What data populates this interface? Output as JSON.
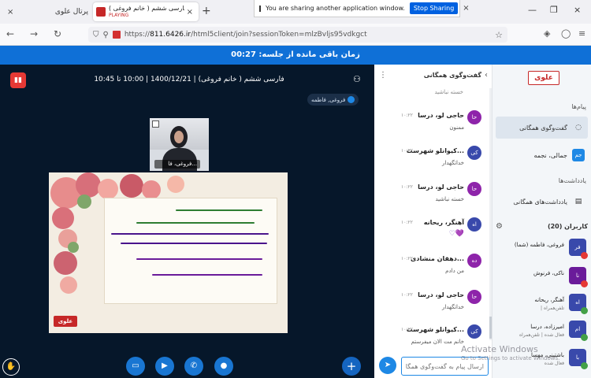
{
  "browser": {
    "tabs": [
      {
        "title": "پرتال علوی"
      },
      {
        "title": "علوی - فارسی ششم ( خانم فروغی )",
        "status": "PLAYING"
      }
    ],
    "new_tab": "+",
    "close_glyph": "×",
    "sharing": {
      "text": "You are sharing another application window.",
      "button": "Stop Sharing"
    },
    "url": {
      "prefix": "https://",
      "host": "811.6426.ir",
      "path": "/html5client/join?sessionToken=mlzBvljs95vdkgct"
    },
    "window_controls": {
      "minimize": "—",
      "restore": "❐",
      "close": "×"
    }
  },
  "app": {
    "timer": "زمان باقی مانده از جلسه: 00:27",
    "session_title": "فارسی ششم ( خانم فروغی) | 1400/12/21 | 10:00 تا 10:45",
    "presenter_tag": "فروغی, فاطمه",
    "webcam_label": "فروغی، فا...",
    "slide_logo": "علوی"
  },
  "chat": {
    "title": "گفت‌وگوی همگانی",
    "input_placeholder": "ارسال پیام به گفت‌وگوی همگانی",
    "top_fragment": "خسته نباشید",
    "messages": [
      {
        "avatar": "حا",
        "name": "حاجی لو، درسا",
        "time": "۱۰:۲۲",
        "text": "ممنون",
        "color": "#8e24aa"
      },
      {
        "avatar": "کی",
        "name": "کیوانلو شهرست...",
        "time": "۱۰:۲۲",
        "text": "خداتگهدار",
        "color": "#3949ab"
      },
      {
        "avatar": "حا",
        "name": "حاجی لو، درسا",
        "time": "۱۰:۲۲",
        "text": "خسته نباشید",
        "color": "#8e24aa"
      },
      {
        "avatar": "اه",
        "name": "آهنگر، ریحانه",
        "time": "۱۰:۲۲",
        "text": "",
        "hearts": "♡💜",
        "color": "#3949ab"
      },
      {
        "avatar": "ده",
        "name": "دهقان منشادی...",
        "time": "۱۰:۲۲",
        "text": "من دادم",
        "color": "#8e24aa"
      },
      {
        "avatar": "حا",
        "name": "حاجی لو، درسا",
        "time": "۱۰:۲۲",
        "text": "خداتگهدار",
        "color": "#8e24aa"
      },
      {
        "avatar": "کی",
        "name": "کیوانلو شهرست...",
        "time": "۱۰:۲۲",
        "text": "خانم مت الان میفرستم",
        "color": "#3949ab"
      }
    ]
  },
  "sidebar": {
    "logo": "علوی",
    "messages_heading": "پیام‌ها",
    "public_chat": "گفت‌وگوی همگانی",
    "private_chat": "جمالی، نجمه",
    "private_avatar": "جم",
    "notes_heading": "یادداشت‌ها",
    "shared_notes": "یادداشت‌های همگانی",
    "users_heading": "کاربران (20)",
    "users": [
      {
        "avatar": "فر",
        "name": "فروغی، فاطمه (شما)",
        "sub": "",
        "color": "#3949ab"
      },
      {
        "avatar": "نا",
        "name": "ناکی، فرنوش",
        "sub": "",
        "color": "#6a1b9a"
      },
      {
        "avatar": "اه",
        "name": "آهنگر، ریحانه",
        "sub": "| تلفن‌همراه",
        "color": "#3949ab"
      },
      {
        "avatar": "ام",
        "name": "امیرزاده، درسا",
        "sub": "فعال شده | تلفن‌همراه",
        "color": "#3949ab"
      },
      {
        "avatar": "با",
        "name": "باشتینی، مهسا",
        "sub": "فعال شده",
        "color": "#3949ab"
      }
    ]
  },
  "watermark": {
    "line1": "Activate Windows",
    "line2": "Go to Settings to activate Windows."
  },
  "icons": {
    "leave": "leave-session-icon",
    "user": "user-icon",
    "send": "send-icon",
    "gear": "gear-icon",
    "raise_hand": "raise-hand-icon",
    "screen": "screen-share-icon",
    "camera": "camera-icon",
    "phone": "phone-icon",
    "mic": "microphone-icon",
    "plus": "plus-icon"
  }
}
